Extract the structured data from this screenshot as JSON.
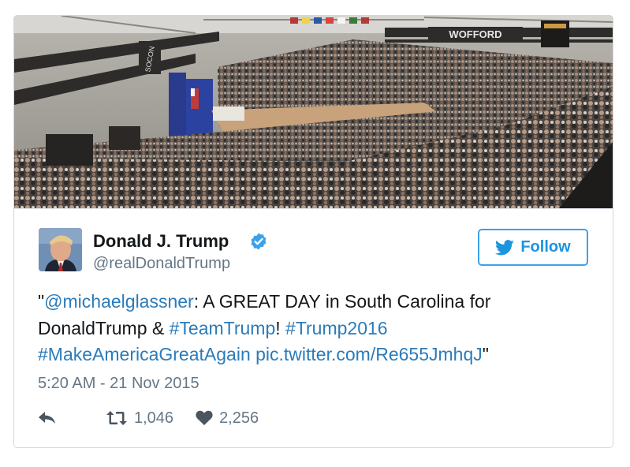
{
  "tweet": {
    "author": {
      "display_name": "Donald J. Trump",
      "handle": "@realDonaldTrump",
      "verified": true
    },
    "follow_label": "Follow",
    "text": {
      "open_quote": "\"",
      "mention": "@michaelglassner",
      "part1": ": A GREAT DAY in South Carolina for DonaldTrump & ",
      "hashtag1": "#TeamTrump",
      "part2": "! ",
      "hashtag2": "#Trump2016",
      "hashtag3": "#MakeAmericaGreatAgain",
      "link": "pic.twitter.com/Re655JmhqJ",
      "close_quote": "\""
    },
    "timestamp": "5:20 AM - 21 Nov 2015",
    "stats": {
      "retweets": "1,046",
      "likes": "2,256"
    }
  },
  "photo": {
    "banner_text": "WOFFORD",
    "wall_sign": "SOCON"
  },
  "colors": {
    "accent": "#1b95e0",
    "link": "#2b7bb9",
    "muted": "#657786",
    "text": "#14171a",
    "verified": "#3da1e7"
  },
  "icons": {
    "verified": "verified-badge-icon",
    "follow": "twitter-bird-icon",
    "reply": "reply-icon",
    "retweet": "retweet-icon",
    "like": "heart-icon"
  }
}
